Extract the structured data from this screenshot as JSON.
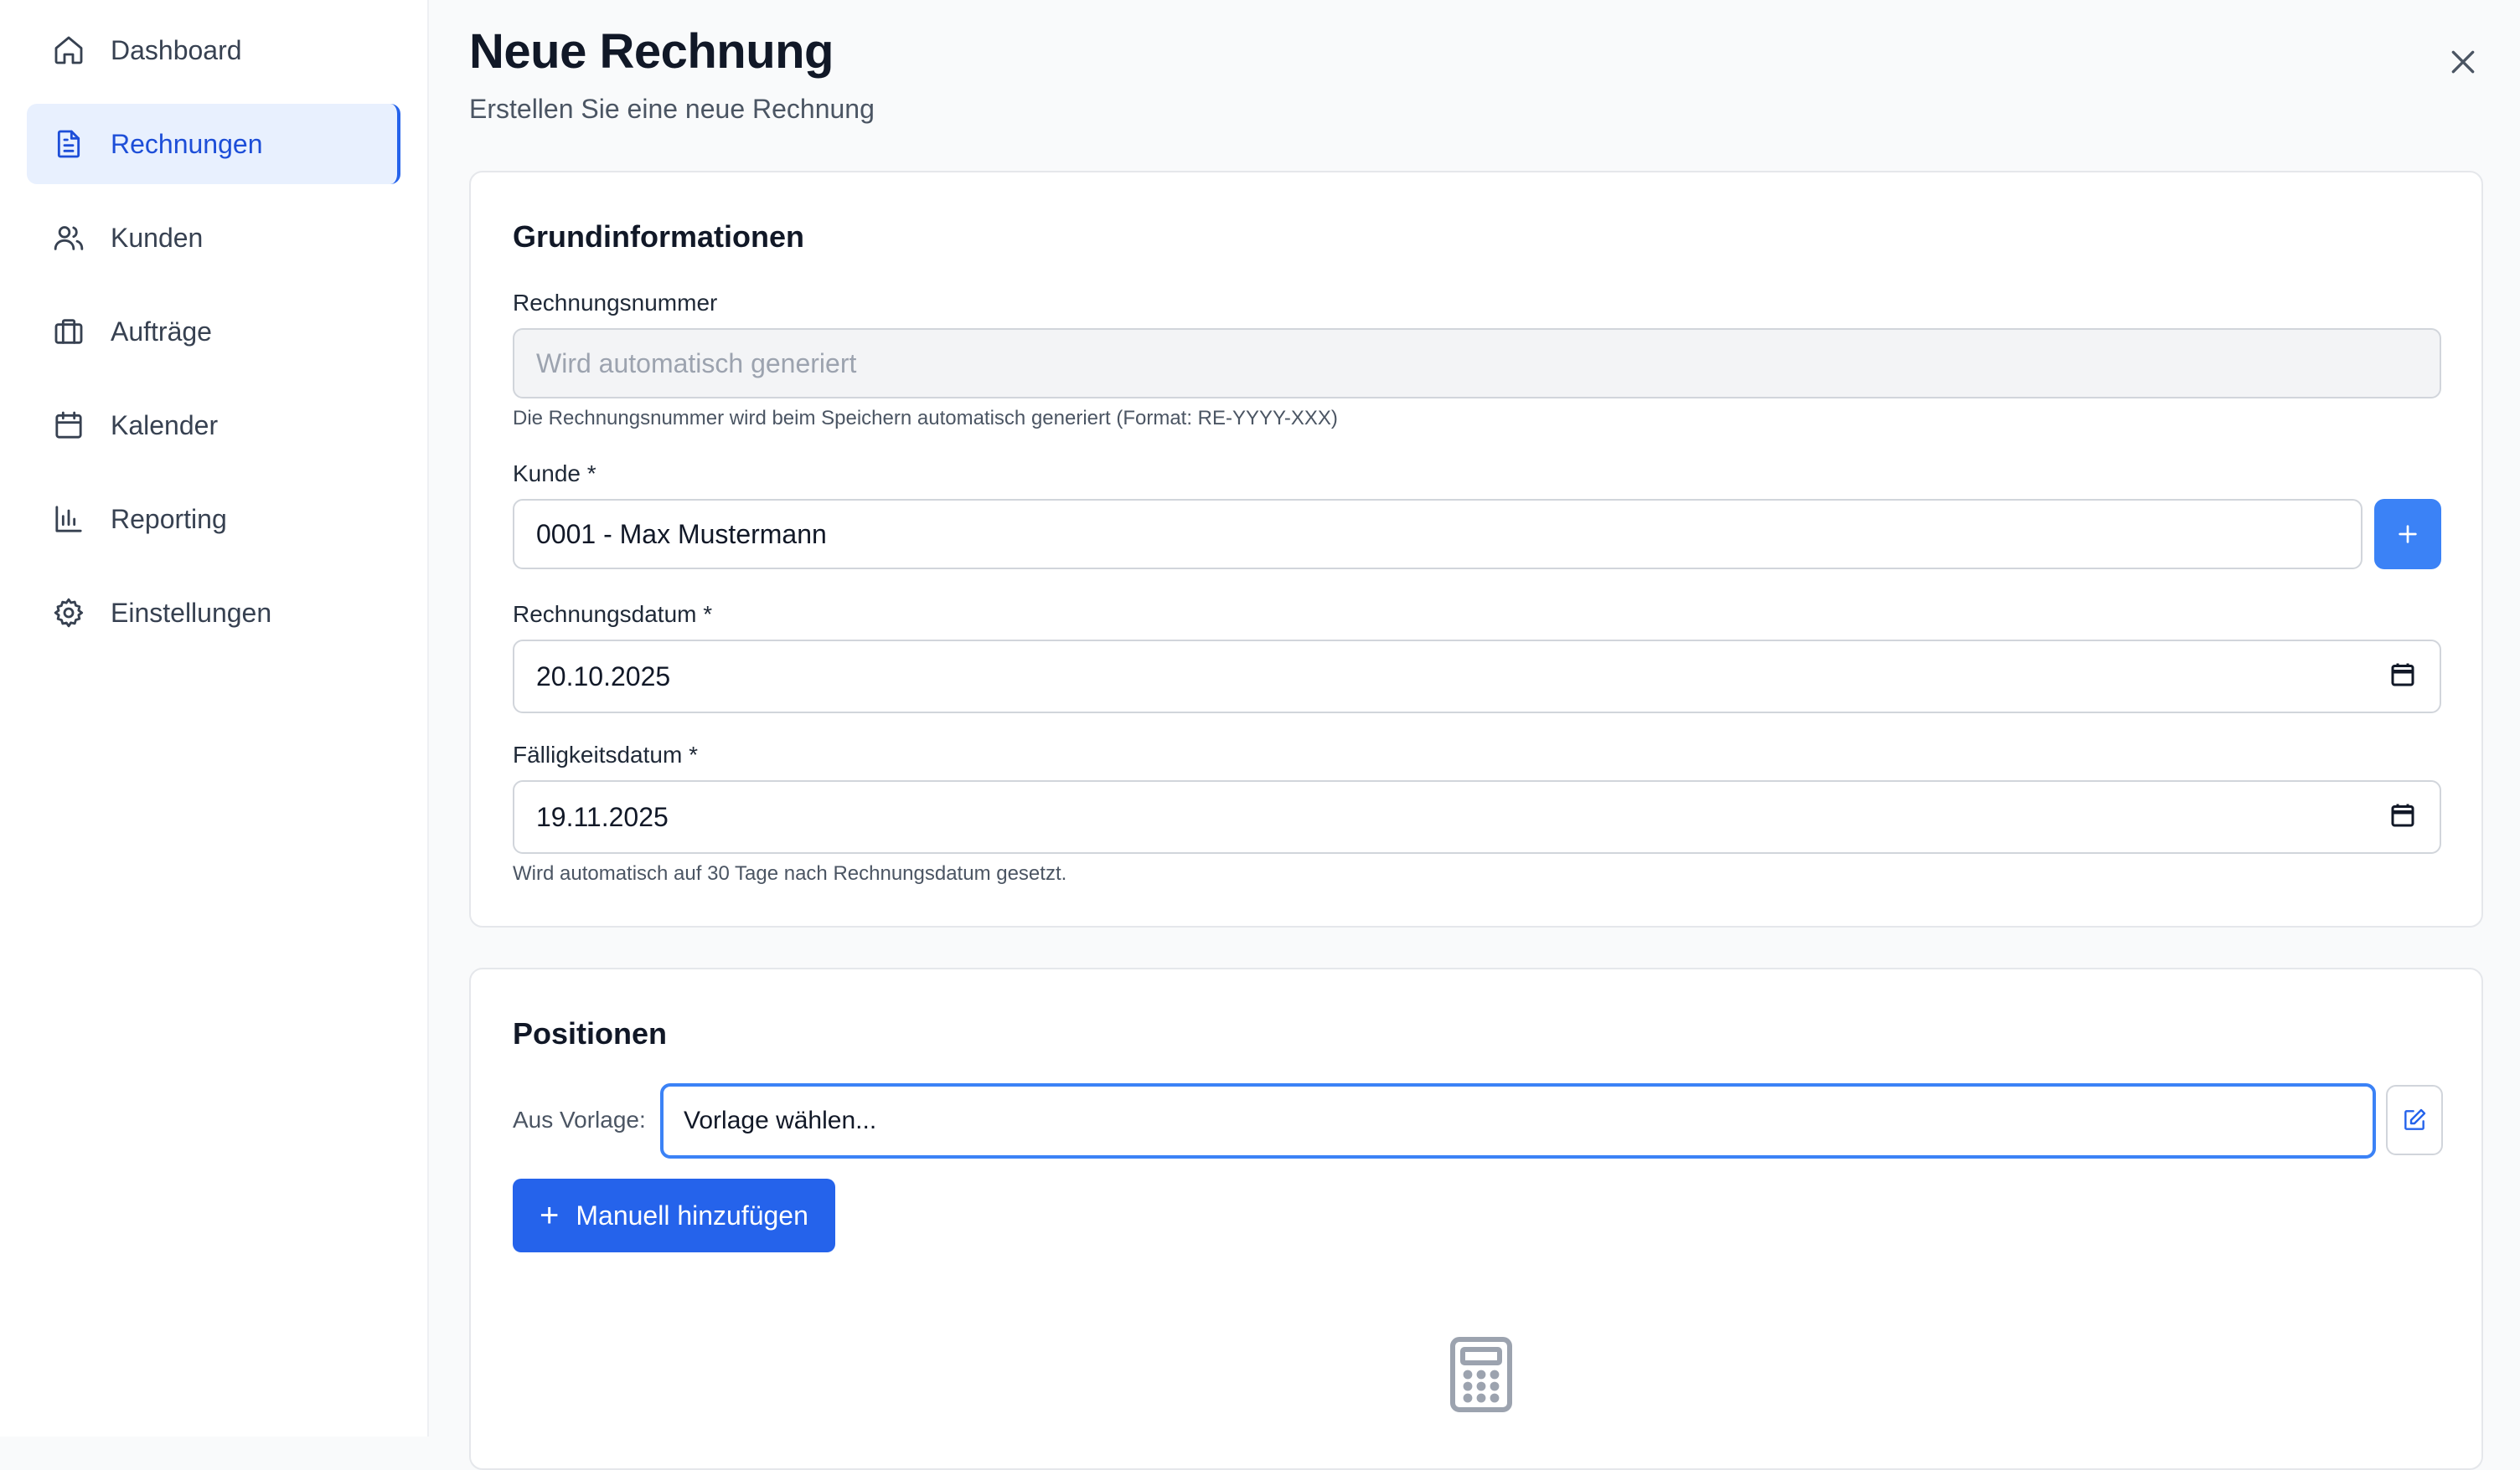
{
  "sidebar": {
    "items": [
      {
        "label": "Dashboard",
        "icon": "home-icon"
      },
      {
        "label": "Rechnungen",
        "icon": "document-icon",
        "active": true
      },
      {
        "label": "Kunden",
        "icon": "users-icon"
      },
      {
        "label": "Aufträge",
        "icon": "briefcase-icon"
      },
      {
        "label": "Kalender",
        "icon": "calendar-icon"
      },
      {
        "label": "Reporting",
        "icon": "bar-chart-icon"
      },
      {
        "label": "Einstellungen",
        "icon": "gear-icon"
      }
    ]
  },
  "header": {
    "title": "Neue Rechnung",
    "subtitle": "Erstellen Sie eine neue Rechnung"
  },
  "basic": {
    "title": "Grundinformationen",
    "invoice_number_label": "Rechnungsnummer",
    "invoice_number_placeholder": "Wird automatisch generiert",
    "invoice_number_hint": "Die Rechnungsnummer wird beim Speichern automatisch generiert (Format: RE-YYYY-XXX)",
    "customer_label": "Kunde *",
    "customer_value": "0001 - Max Mustermann",
    "invoice_date_label": "Rechnungsdatum *",
    "invoice_date_value": "20.10.2025",
    "due_date_label": "Fälligkeitsdatum *",
    "due_date_value": "19.11.2025",
    "due_date_hint": "Wird automatisch auf 30 Tage nach Rechnungsdatum gesetzt."
  },
  "positions": {
    "title": "Positionen",
    "template_label": "Aus Vorlage:",
    "template_value": "Vorlage wählen...",
    "add_manual_label": "Manuell hinzufügen"
  },
  "colors": {
    "accent": "#2563eb",
    "active_bg": "#e8f0fe"
  }
}
